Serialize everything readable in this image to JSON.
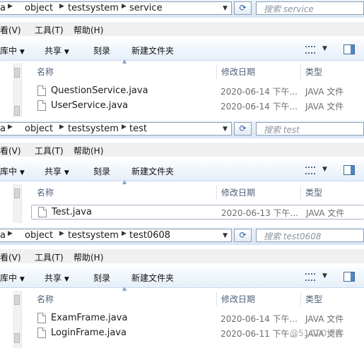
{
  "panes": [
    {
      "crumbs": [
        "a",
        "object",
        "testsystem",
        "service"
      ],
      "search_placeholder": "搜索 service",
      "menu": [
        "看(V)",
        "工具(T)",
        "帮助(H)"
      ],
      "commands": {
        "organize": "库中",
        "share": "共享",
        "burn": "刻录",
        "new_folder": "新建文件夹"
      },
      "columns": {
        "name": "名称",
        "date": "修改日期",
        "type": "类型"
      },
      "files": [
        {
          "name": "QuestionService.java",
          "date": "2020-06-14 下午...",
          "type": "JAVA 文件"
        },
        {
          "name": "UserService.java",
          "date": "2020-06-14 下午...",
          "type": "JAVA 文件"
        }
      ]
    },
    {
      "crumbs": [
        "a",
        "object",
        "testsystem",
        "test"
      ],
      "search_placeholder": "搜索 test",
      "menu": [
        "看(V)",
        "工具(T)",
        "帮助(H)"
      ],
      "commands": {
        "organize": "库中",
        "share": "共享",
        "burn": "刻录",
        "new_folder": "新建文件夹"
      },
      "columns": {
        "name": "名称",
        "date": "修改日期",
        "type": "类型"
      },
      "files": [
        {
          "name": "Test.java",
          "date": "2020-06-13 下午...",
          "type": "JAVA 文件"
        }
      ]
    },
    {
      "crumbs": [
        "a",
        "object",
        "testsystem",
        "test0608"
      ],
      "search_placeholder": "搜索 test0608",
      "menu": [
        "看(V)",
        "工具(T)",
        "帮助(H)"
      ],
      "commands": {
        "organize": "库中",
        "share": "共享",
        "burn": "刻录",
        "new_folder": "新建文件夹"
      },
      "columns": {
        "name": "名称",
        "date": "修改日期",
        "type": "类型"
      },
      "files": [
        {
          "name": "ExamFrame.java",
          "date": "2020-06-14 下午...",
          "type": "JAVA 文件"
        },
        {
          "name": "LoginFrame.java",
          "date": "2020-06-11 下午...",
          "type": "JAVA 文件"
        }
      ]
    }
  ],
  "watermark": "@51CTO博客",
  "icons": {
    "breadcrumb_separator": "chevron-right-icon",
    "dropdown": "chevron-down-icon",
    "refresh": "refresh-icon",
    "search": "search-icon",
    "view_options": "details-view-icon",
    "preview_pane": "preview-pane-icon",
    "file": "java-file-icon"
  },
  "colors": {
    "address_bar": "#d9e6f5",
    "command_bar": "#e5eef9",
    "column_header_text": "#4c607a",
    "meta_text": "#6d6d6d"
  }
}
